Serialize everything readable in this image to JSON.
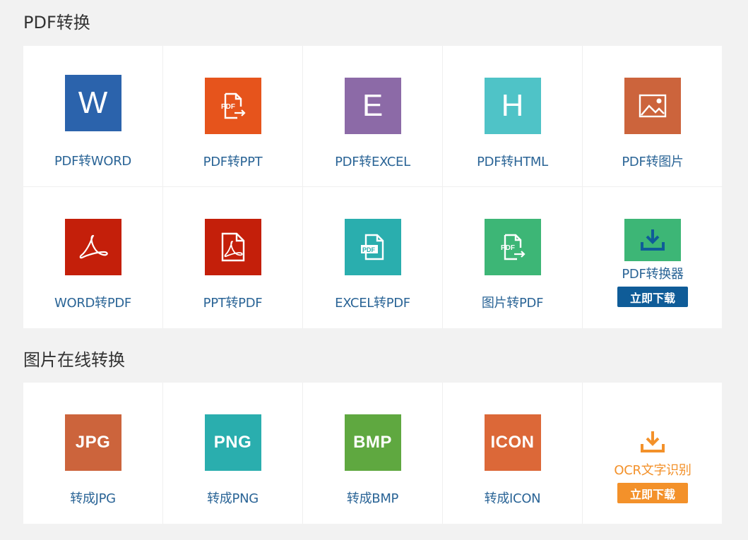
{
  "sections": [
    {
      "title": "PDF转换",
      "items": [
        {
          "label": "PDF转WORD",
          "icon": "word-letter-icon",
          "glyph": "W",
          "color": "#2b63ac"
        },
        {
          "label": "PDF转PPT",
          "icon": "pdf-export-icon",
          "color": "#e6541c"
        },
        {
          "label": "PDF转EXCEL",
          "icon": "excel-letter-icon",
          "glyph": "E",
          "color": "#8c6aa7"
        },
        {
          "label": "PDF转HTML",
          "icon": "html-letter-icon",
          "glyph": "H",
          "color": "#4fc3c7"
        },
        {
          "label": "PDF转图片",
          "icon": "image-icon",
          "color": "#cc643c"
        },
        {
          "label": "WORD转PDF",
          "icon": "acrobat-icon",
          "color": "#c41f0a"
        },
        {
          "label": "PPT转PDF",
          "icon": "acrobat-document-icon",
          "color": "#c41f0a"
        },
        {
          "label": "EXCEL转PDF",
          "icon": "pdf-document-icon",
          "color": "#2aaeae"
        },
        {
          "label": "图片转PDF",
          "icon": "pdf-export-icon",
          "color": "#3db676"
        },
        {
          "label": "PDF转换器",
          "icon": "download-icon",
          "color": "#3db676",
          "button": "立即下载",
          "button_color": "#0f5c98"
        }
      ]
    },
    {
      "title": "图片在线转换",
      "items": [
        {
          "label": "转成JPG",
          "icon": "jpg-text-icon",
          "glyph": "JPG",
          "color": "#cc643c"
        },
        {
          "label": "转成PNG",
          "icon": "png-text-icon",
          "glyph": "PNG",
          "color": "#2aaeae"
        },
        {
          "label": "转成BMP",
          "icon": "bmp-text-icon",
          "glyph": "BMP",
          "color": "#5fa840"
        },
        {
          "label": "转成ICON",
          "icon": "icon-text-icon",
          "glyph": "ICON",
          "color": "#dc6838"
        },
        {
          "label": "OCR文字识别",
          "icon": "download-icon",
          "color": "#f3912a",
          "button": "立即下载",
          "button_color": "#f3912a"
        }
      ]
    }
  ]
}
